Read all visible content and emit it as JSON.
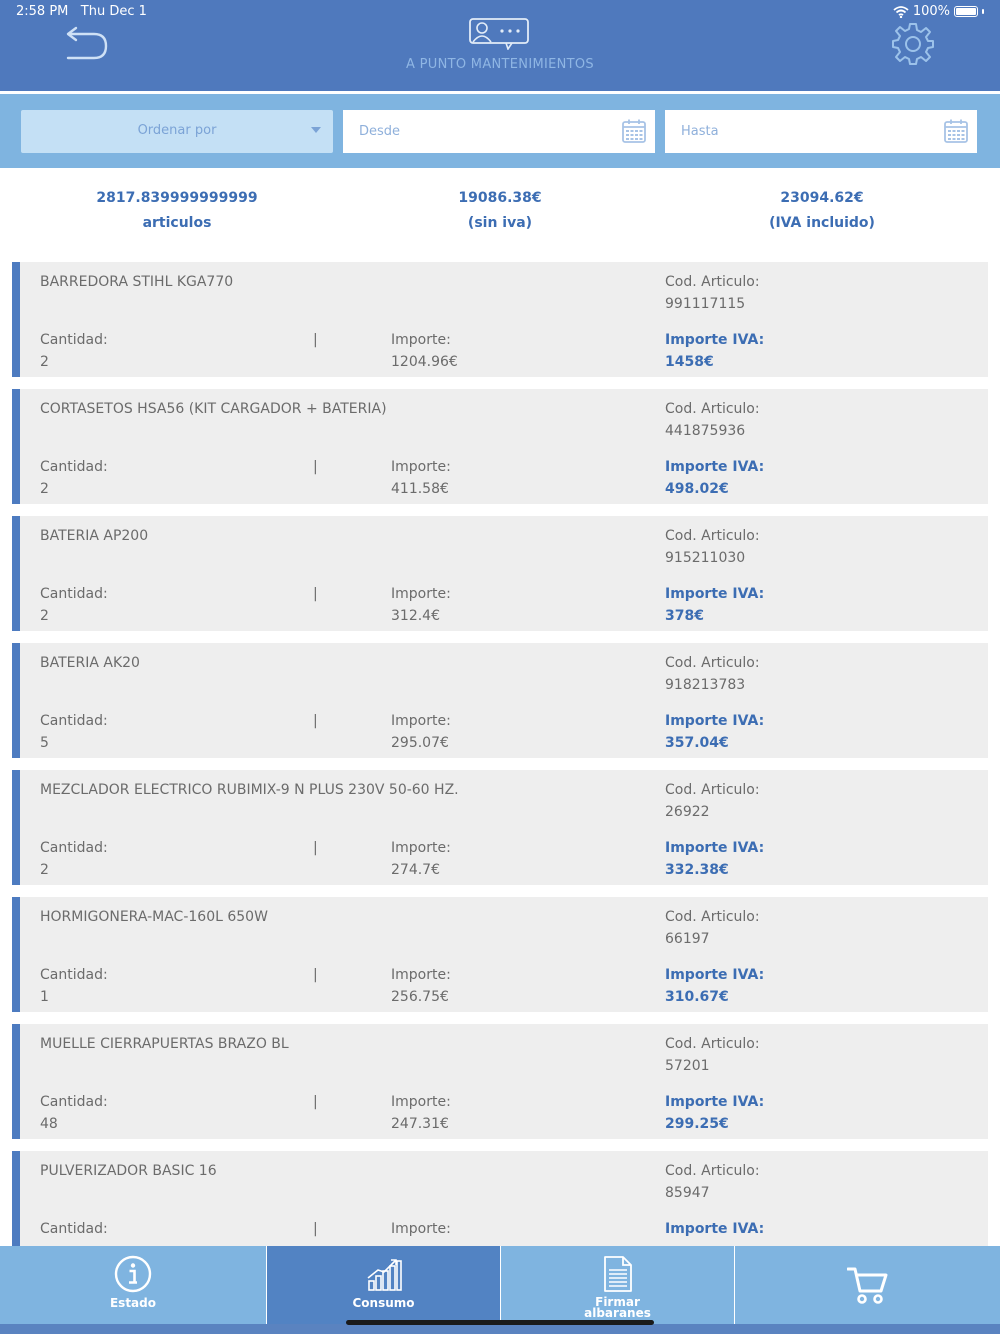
{
  "status_bar": {
    "time": "2:58 PM",
    "date": "Thu Dec 1",
    "battery": "100%"
  },
  "header": {
    "title": "A PUNTO MANTENIMIENTOS"
  },
  "filters": {
    "order_label": "Ordenar por",
    "desde_placeholder": "Desde",
    "hasta_placeholder": "Hasta"
  },
  "summary": [
    {
      "value": "2817.839999999999",
      "label": "articulos"
    },
    {
      "value": "19086.38€",
      "label": "(sin iva)"
    },
    {
      "value": "23094.62€",
      "label": "(IVA incluido)"
    }
  ],
  "labels": {
    "cod": "Cod. Articulo:",
    "cantidad": "Cantidad:",
    "separator": "|",
    "importe": "Importe:",
    "importe_iva": "Importe IVA:"
  },
  "items": [
    {
      "name": "BARREDORA STIHL KGA770",
      "code": "991117115",
      "cantidad": "2",
      "importe": "1204.96€",
      "importe_iva": "1458€"
    },
    {
      "name": "CORTASETOS HSA56 (KIT CARGADOR + BATERIA)",
      "code": "441875936",
      "cantidad": "2",
      "importe": "411.58€",
      "importe_iva": "498.02€"
    },
    {
      "name": "BATERIA AP200",
      "code": "915211030",
      "cantidad": "2",
      "importe": "312.4€",
      "importe_iva": "378€"
    },
    {
      "name": "BATERIA AK20",
      "code": "918213783",
      "cantidad": "5",
      "importe": "295.07€",
      "importe_iva": "357.04€"
    },
    {
      "name": "MEZCLADOR ELECTRICO RUBIMIX-9 N PLUS 230V 50-60 HZ.",
      "code": "26922",
      "cantidad": "2",
      "importe": "274.7€",
      "importe_iva": "332.38€"
    },
    {
      "name": "HORMIGONERA-MAC-160L 650W",
      "code": "66197",
      "cantidad": "1",
      "importe": "256.75€",
      "importe_iva": "310.67€"
    },
    {
      "name": "MUELLE CIERRAPUERTAS BRAZO BL",
      "code": "57201",
      "cantidad": "48",
      "importe": "247.31€",
      "importe_iva": "299.25€"
    },
    {
      "name": "PULVERIZADOR BASIC 16",
      "code": "85947",
      "cantidad": "",
      "importe": "",
      "importe_iva": ""
    }
  ],
  "tabs": [
    {
      "label": "Estado",
      "icon": "info-icon"
    },
    {
      "label": "Consumo",
      "icon": "chart-icon"
    },
    {
      "label": "Firmar",
      "label2": "albaranes",
      "icon": "document-icon"
    },
    {
      "label": "",
      "icon": "cart-icon"
    }
  ],
  "colors": {
    "header": "#4f79bd",
    "filter_bar": "#7fb4e0",
    "accent": "#3c6db3",
    "active_tab": "#5283c3",
    "card": "#eeeeee"
  }
}
